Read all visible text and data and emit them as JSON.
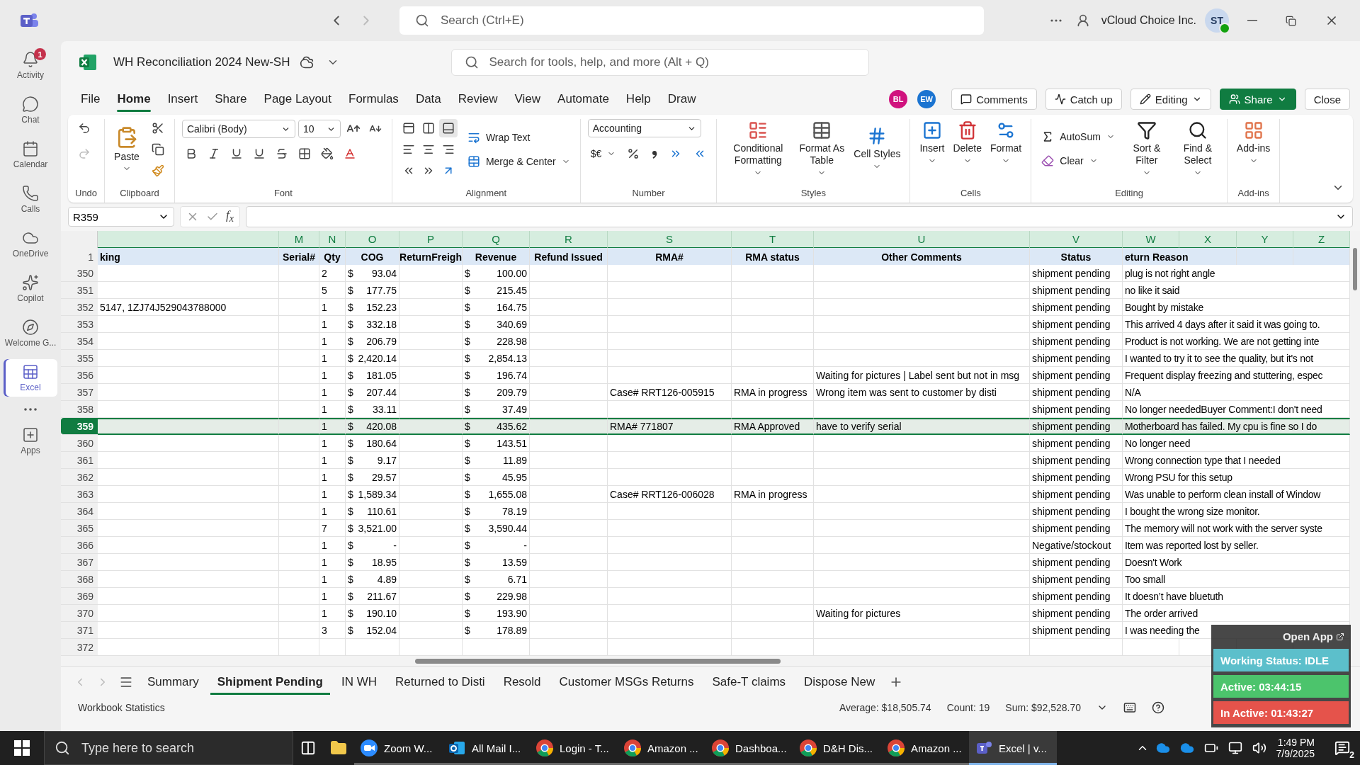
{
  "teams_bar": {
    "search": {
      "placeholder": "Search (Ctrl+E)"
    },
    "org": "vCloud Choice Inc.",
    "avatar": "ST"
  },
  "rail": [
    {
      "kind": "bell",
      "label": "Activity",
      "badge": "1",
      "selected": false
    },
    {
      "kind": "chat",
      "label": "Chat",
      "selected": false
    },
    {
      "kind": "calendar",
      "label": "Calendar",
      "selected": false
    },
    {
      "kind": "calls",
      "label": "Calls",
      "selected": false
    },
    {
      "kind": "cloud",
      "label": "OneDrive",
      "selected": false
    },
    {
      "kind": "copilot",
      "label": "Copilot",
      "selected": false
    },
    {
      "kind": "compass",
      "label": "Welcome G...",
      "selected": false
    },
    {
      "kind": "excel",
      "label": "Excel",
      "selected": true
    },
    {
      "kind": "more",
      "selected": false
    },
    {
      "kind": "apps",
      "label": "Apps",
      "selected": false
    }
  ],
  "document": {
    "title": "WH Reconciliation 2024 New-SH",
    "search": {
      "placeholder": "Search for tools, help, and more (Alt + Q)"
    }
  },
  "ribbon_tabs": [
    {
      "label": "File",
      "selected": false
    },
    {
      "label": "Home",
      "selected": true
    },
    {
      "label": "Insert",
      "selected": false
    },
    {
      "label": "Share",
      "selected": false
    },
    {
      "label": "Page Layout",
      "selected": false
    },
    {
      "label": "Formulas",
      "selected": false
    },
    {
      "label": "Data",
      "selected": false
    },
    {
      "label": "Review",
      "selected": false
    },
    {
      "label": "View",
      "selected": false
    },
    {
      "label": "Automate",
      "selected": false
    },
    {
      "label": "Help",
      "selected": false
    },
    {
      "label": "Draw",
      "selected": false
    }
  ],
  "collaborators": [
    {
      "initials": "BL",
      "color": "#d0137e"
    },
    {
      "initials": "EW",
      "color": "#1b74d1"
    }
  ],
  "actions": [
    {
      "kind": "comments",
      "label": "Comments"
    },
    {
      "kind": "catchup",
      "label": "Catch up"
    },
    {
      "kind": "editing",
      "label": "Editing"
    },
    {
      "kind": "share",
      "label": "Share"
    },
    {
      "kind": "close",
      "label": "Close"
    }
  ],
  "ribbon": [
    {
      "kind": "undo",
      "label": "Undo"
    },
    {
      "kind": "clipboard",
      "label": "Clipboard",
      "paste": "Paste"
    },
    {
      "kind": "font",
      "label": "Font",
      "font": "Calibri (Body)",
      "size": "10"
    },
    {
      "kind": "alignment",
      "label": "Alignment",
      "wrap": "Wrap Text",
      "merge": "Merge & Center"
    },
    {
      "kind": "number",
      "label": "Number",
      "format": "Accounting",
      "currency": "$€"
    },
    {
      "kind": "styles",
      "label": "Styles",
      "buttons": [
        "Conditional Formatting",
        "Format As Table",
        "Cell Styles"
      ]
    },
    {
      "kind": "cells",
      "label": "Cells",
      "buttons": [
        "Insert",
        "Delete",
        "Format"
      ]
    },
    {
      "kind": "editing",
      "label": "Editing",
      "autosum": "AutoSum",
      "clear": "Clear",
      "buttons": [
        "Sort & Filter",
        "Find & Select"
      ]
    },
    {
      "kind": "addins",
      "label": "Add-ins",
      "buttons": [
        "Add-ins"
      ]
    }
  ],
  "formula_bar": {
    "name_box": "R359",
    "fx": "f$_{x}$"
  },
  "sheet": {
    "column_letters": [
      "M",
      "N",
      "O",
      "P",
      "Q",
      "R",
      "S",
      "T",
      "U",
      "V",
      "W",
      "X",
      "Y",
      "Z"
    ],
    "header_row": {
      "number": "1",
      "cells": [
        "king",
        "Serial#",
        "Qty",
        "COG",
        "ReturnFreigh",
        "Revenue",
        "Refund Issued",
        "RMA#",
        "RMA status",
        "Other Comments",
        "Status",
        "eturn Reason"
      ]
    },
    "rows": [
      {
        "number": "350",
        "qty": "2",
        "cog": {
          "sign": "$",
          "amount": "93.04"
        },
        "revenue": {
          "sign": "$",
          "amount": "100.00"
        },
        "status": "shipment pending",
        "reason": "plug is not right angle",
        "selected": false
      },
      {
        "number": "351",
        "qty": "5",
        "cog": {
          "sign": "$",
          "amount": "177.75"
        },
        "revenue": {
          "sign": "$",
          "amount": "215.45"
        },
        "status": "shipment pending",
        "reason": "no like it said",
        "selected": false
      },
      {
        "number": "352",
        "tracking": "5147, 1ZJ74J529043788000",
        "qty": "1",
        "cog": {
          "sign": "$",
          "amount": "152.23"
        },
        "revenue": {
          "sign": "$",
          "amount": "164.75"
        },
        "status": "shipment pending",
        "reason": "Bought by mistake",
        "selected": false
      },
      {
        "number": "353",
        "qty": "1",
        "cog": {
          "sign": "$",
          "amount": "332.18"
        },
        "revenue": {
          "sign": "$",
          "amount": "340.69"
        },
        "status": "shipment pending",
        "reason": "This arrived 4 days after it said it was going to.",
        "selected": false
      },
      {
        "number": "354",
        "qty": "1",
        "cog": {
          "sign": "$",
          "amount": "206.79"
        },
        "revenue": {
          "sign": "$",
          "amount": "228.98"
        },
        "status": "shipment pending",
        "reason": "Product is not working. We are not getting inte",
        "selected": false
      },
      {
        "number": "355",
        "qty": "1",
        "cog": {
          "sign": "$",
          "amount": "2,420.14"
        },
        "revenue": {
          "sign": "$",
          "amount": "2,854.13"
        },
        "status": "shipment pending",
        "reason": "I wanted to try it to see the quality, but it's not",
        "selected": false
      },
      {
        "number": "356",
        "qty": "1",
        "cog": {
          "sign": "$",
          "amount": "181.05"
        },
        "revenue": {
          "sign": "$",
          "amount": "196.74"
        },
        "comments": "Waiting for pictures | Label sent but not in msg",
        "status": "shipment pending",
        "reason": "Frequent display freezing and stuttering, espec",
        "selected": false
      },
      {
        "number": "357",
        "qty": "1",
        "cog": {
          "sign": "$",
          "amount": "207.44"
        },
        "revenue": {
          "sign": "$",
          "amount": "209.79"
        },
        "rma": "Case# RRT126-005915",
        "rma_status": "RMA in progress",
        "comments": "Wrong item was sent to customer by disti",
        "status": "shipment pending",
        "reason": "N/A",
        "selected": false
      },
      {
        "number": "358",
        "qty": "1",
        "cog": {
          "sign": "$",
          "amount": "33.11"
        },
        "revenue": {
          "sign": "$",
          "amount": "37.49"
        },
        "status": "shipment pending",
        "reason": "No longer neededBuyer Comment:I don't need",
        "selected": false
      },
      {
        "number": "359",
        "qty": "1",
        "cog": {
          "sign": "$",
          "amount": "420.08"
        },
        "revenue": {
          "sign": "$",
          "amount": "435.62"
        },
        "rma": "RMA# 771807",
        "rma_status": "RMA Approved",
        "comments": "have to verify serial",
        "status": "shipment pending",
        "reason": "Motherboard has failed. My cpu is fine so I do",
        "selected": true
      },
      {
        "number": "360",
        "qty": "1",
        "cog": {
          "sign": "$",
          "amount": "180.64"
        },
        "revenue": {
          "sign": "$",
          "amount": "143.51"
        },
        "status": "shipment pending",
        "reason": "No longer need",
        "selected": false
      },
      {
        "number": "361",
        "qty": "1",
        "cog": {
          "sign": "$",
          "amount": "9.17"
        },
        "revenue": {
          "sign": "$",
          "amount": "11.89"
        },
        "status": "shipment pending",
        "reason": "Wrong connection type that I needed",
        "selected": false
      },
      {
        "number": "362",
        "qty": "1",
        "cog": {
          "sign": "$",
          "amount": "29.57"
        },
        "revenue": {
          "sign": "$",
          "amount": "45.95"
        },
        "status": "shipment pending",
        "reason": "Wrong PSU for this setup",
        "selected": false
      },
      {
        "number": "363",
        "qty": "1",
        "cog": {
          "sign": "$",
          "amount": "1,589.34"
        },
        "revenue": {
          "sign": "$",
          "amount": "1,655.08"
        },
        "rma": "Case# RRT126-006028",
        "rma_status": "RMA in progress",
        "status": "shipment pending",
        "reason": "Was unable to perform clean install of Window",
        "selected": false
      },
      {
        "number": "364",
        "qty": "1",
        "cog": {
          "sign": "$",
          "amount": "110.61"
        },
        "revenue": {
          "sign": "$",
          "amount": "78.19"
        },
        "status": "shipment pending",
        "reason": "I bought the wrong size monitor.",
        "selected": false
      },
      {
        "number": "365",
        "qty": "7",
        "cog": {
          "sign": "$",
          "amount": "3,521.00"
        },
        "revenue": {
          "sign": "$",
          "amount": "3,590.44"
        },
        "status": "shipment pending",
        "reason": "The memory will not work with the server syste",
        "selected": false
      },
      {
        "number": "366",
        "qty": "1",
        "cog": {
          "sign": "$",
          "amount": "-"
        },
        "revenue": {
          "sign": "$",
          "amount": "-"
        },
        "status": "Negative/stockout",
        "reason": "Item was reported lost by seller.",
        "selected": false
      },
      {
        "number": "367",
        "qty": "1",
        "cog": {
          "sign": "$",
          "amount": "18.95"
        },
        "revenue": {
          "sign": "$",
          "amount": "13.59"
        },
        "status": "shipment pending",
        "reason": "Doesn't Work",
        "selected": false
      },
      {
        "number": "368",
        "qty": "1",
        "cog": {
          "sign": "$",
          "amount": "4.89"
        },
        "revenue": {
          "sign": "$",
          "amount": "6.71"
        },
        "status": "shipment pending",
        "reason": "Too small",
        "selected": false
      },
      {
        "number": "369",
        "qty": "1",
        "cog": {
          "sign": "$",
          "amount": "211.67"
        },
        "revenue": {
          "sign": "$",
          "amount": "229.98"
        },
        "status": "shipment pending",
        "reason": "It doesn’t have bluetuth",
        "selected": false
      },
      {
        "number": "370",
        "qty": "1",
        "cog": {
          "sign": "$",
          "amount": "190.10"
        },
        "revenue": {
          "sign": "$",
          "amount": "193.90"
        },
        "comments": "Waiting for pictures",
        "status": "shipment pending",
        "reason": "The order arrived",
        "selected": false
      },
      {
        "number": "371",
        "qty": "3",
        "cog": {
          "sign": "$",
          "amount": "152.04"
        },
        "revenue": {
          "sign": "$",
          "amount": "178.89"
        },
        "status": "shipment pending",
        "reason": "I was needing the",
        "selected": false
      },
      {
        "number": "372",
        "selected": false
      }
    ]
  },
  "sheet_tabs": [
    {
      "label": "Summary",
      "selected": false
    },
    {
      "label": "Shipment Pending",
      "selected": true
    },
    {
      "label": "IN WH",
      "selected": false
    },
    {
      "label": "Returned to Disti",
      "selected": false
    },
    {
      "label": "Resold",
      "selected": false
    },
    {
      "label": "Customer MSGs Returns",
      "selected": false
    },
    {
      "label": "Safe-T claims",
      "selected": false
    },
    {
      "label": "Dispose New",
      "selected": false
    }
  ],
  "status_bar": {
    "left": "Workbook Statistics",
    "stats": [
      "Average: $18,505.74",
      "Count: 19",
      "Sum: $92,528.70"
    ]
  },
  "tracker_widget": {
    "open": "Open App",
    "items": [
      {
        "label": "Working Status: IDLE",
        "color": "#5cbfcb"
      },
      {
        "label": "Active: 03:44:15",
        "color": "#4cc46c"
      },
      {
        "label": "In Active: 01:43:27",
        "color": "#e5534b"
      }
    ]
  },
  "taskbar": {
    "search": {
      "placeholder": "Type here to search"
    },
    "apps": [
      {
        "kind": "zoom",
        "label": "Zoom W...",
        "selected": false
      },
      {
        "kind": "outlook",
        "label": "All Mail I...",
        "selected": false
      },
      {
        "kind": "chrome",
        "label": "Login - T...",
        "selected": false
      },
      {
        "kind": "chrome",
        "label": "Amazon ...",
        "selected": false
      },
      {
        "kind": "chrome",
        "label": "Dashboa...",
        "selected": false
      },
      {
        "kind": "chrome",
        "label": "D&H Dis...",
        "selected": false
      },
      {
        "kind": "chrome",
        "label": "Amazon ...",
        "selected": false
      },
      {
        "kind": "teams",
        "label": "Excel | v...",
        "selected": true
      }
    ],
    "time": "1:49 PM",
    "date": "7/9/2025",
    "notifications": "2"
  }
}
